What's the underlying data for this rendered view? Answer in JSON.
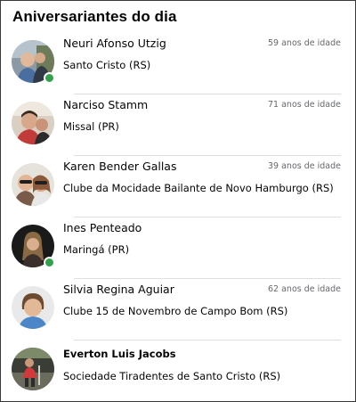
{
  "widget": {
    "title": "Aniversariantes do dia"
  },
  "people": [
    {
      "name": "Neuri Afonso Utzig",
      "age": "59 anos de idade",
      "place": "Santo Cristo (RS)",
      "online": true
    },
    {
      "name": "Narciso Stamm",
      "age": "71 anos de idade",
      "place": "Missal (PR)",
      "online": false
    },
    {
      "name": "Karen Bender Gallas",
      "age": "39 anos de idade",
      "place": "Clube da Mocidade  Bailante de Novo Hamburgo (RS)",
      "online": false
    },
    {
      "name": "Ines Penteado",
      "age": "",
      "place": "Maringá (PR)",
      "online": true
    },
    {
      "name": "Silvia Regina Aguiar",
      "age": "62 anos de idade",
      "place": "Clube 15 de Novembro  de Campo Bom (RS)",
      "online": false
    },
    {
      "name": "Everton Luis Jacobs",
      "age": "",
      "place": "Sociedade Tiradentes de Santo Cristo (RS)",
      "online": false
    }
  ],
  "colors": {
    "online": "#31a24c",
    "divider": "#dddfe2",
    "secondary_text": "#65676b"
  }
}
